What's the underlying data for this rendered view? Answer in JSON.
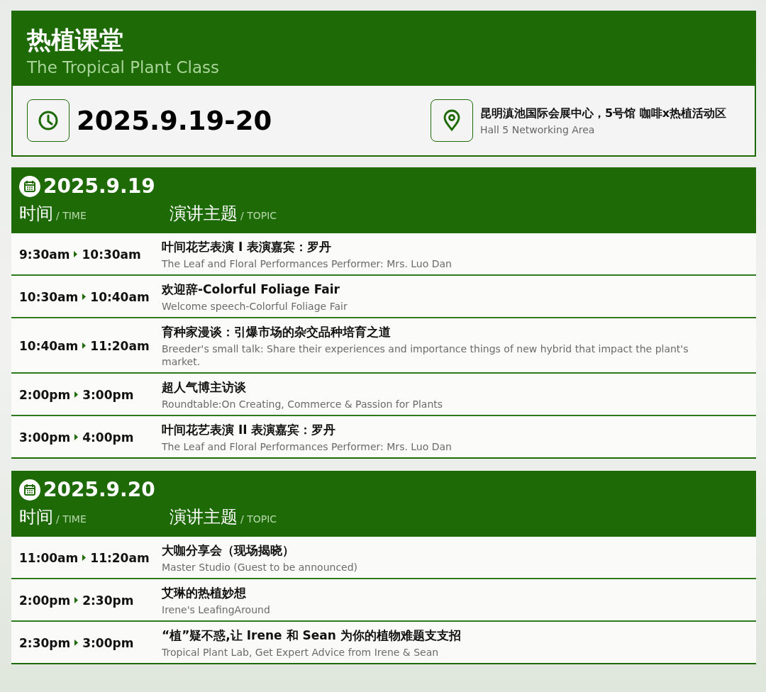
{
  "header": {
    "title": "热植课堂",
    "subtitle": "The Tropical Plant Class"
  },
  "info": {
    "date": "2025.9.19-20",
    "venue": "昆明滇池国际会展中心，5号馆 咖啡x热植活动区",
    "venue_en": "Hall 5 Networking Area"
  },
  "days": [
    {
      "date": "2025.9.19",
      "time_label": "时间",
      "time_label_en": "/ TIME",
      "topic_label": "演讲主题",
      "topic_label_en": "/ TOPIC",
      "sessions": [
        {
          "start": "9:30am",
          "end": "10:30am",
          "title": "叶间花艺表演 I 表演嘉宾：罗丹",
          "subtitle": "The Leaf and Floral Performances   Performer: Mrs. Luo Dan"
        },
        {
          "start": "10:30am",
          "end": "10:40am",
          "title": "欢迎辞-Colorful Foliage Fair",
          "subtitle": "Welcome speech-Colorful Foliage Fair"
        },
        {
          "start": "10:40am",
          "end": "11:20am",
          "title": "育种家漫谈：引爆市场的杂交品种培育之道",
          "subtitle": "Breeder's small talk: Share their experiences and importance things of new hybrid that impact the plant's market."
        },
        {
          "start": "2:00pm",
          "end": "3:00pm",
          "title": "超人气博主访谈",
          "subtitle": "Roundtable:On Creating, Commerce & Passion for Plants"
        },
        {
          "start": "3:00pm",
          "end": "4:00pm",
          "title": "叶间花艺表演 II 表演嘉宾：罗丹",
          "subtitle": "The Leaf and Floral Performances   Performer: Mrs. Luo Dan"
        }
      ]
    },
    {
      "date": "2025.9.20",
      "time_label": "时间",
      "time_label_en": "/ TIME",
      "topic_label": "演讲主题",
      "topic_label_en": "/ TOPIC",
      "sessions": [
        {
          "start": "11:00am",
          "end": "11:20am",
          "title": "大咖分享会（现场揭晓）",
          "subtitle": "Master Studio (Guest to be announced)"
        },
        {
          "start": "2:00pm",
          "end": "2:30pm",
          "title": "艾琳的热植妙想",
          "subtitle": "Irene's LeafingAround"
        },
        {
          "start": "2:30pm",
          "end": "3:00pm",
          "title": "“植”疑不惑,让 Irene 和 Sean 为你的植物难题支支招",
          "subtitle": "Tropical Plant Lab, Get Expert Advice from Irene & Sean"
        }
      ]
    }
  ]
}
